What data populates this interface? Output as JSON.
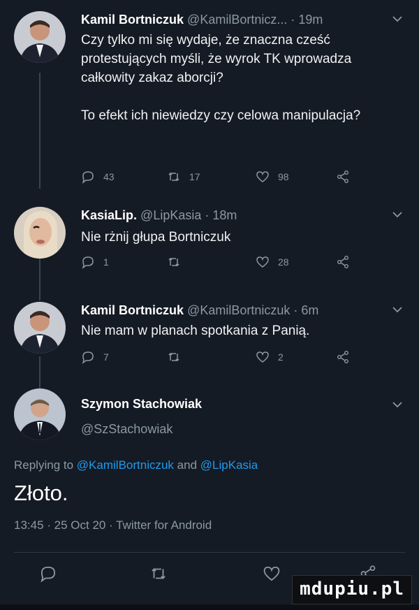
{
  "tweets": [
    {
      "name": "Kamil Bortniczuk",
      "handle": "@KamilBortnicz...",
      "time": "· 19m",
      "text": "Czy tylko mi się wydaje, że znaczna cześć protestujących myśli, że wyrok TK wprowadza całkowity zakaz aborcji?\n\nTo efekt ich niewiedzy czy celowa manipulacja?",
      "replies": "43",
      "retweets": "17",
      "likes": "98"
    },
    {
      "name": "KasiaLip.",
      "handle": "@LipKasia",
      "time": "· 18m",
      "text": "Nie rżnij głupa Bortniczuk",
      "replies": "1",
      "retweets": "",
      "likes": "28"
    },
    {
      "name": "Kamil Bortniczuk",
      "handle": "@KamilBortniczuk",
      "time": "· 6m",
      "text": "Nie mam w planach spotkania z Panią.",
      "replies": "7",
      "retweets": "",
      "likes": "2"
    }
  ],
  "main_tweet": {
    "name": "Szymon Stachowiak",
    "handle": "@SzStachowiak",
    "replying_prefix": "Replying to",
    "mention_1": "@KamilBortniczuk",
    "and_word": "and",
    "mention_2": "@LipKasia",
    "text": "Złoto.",
    "timestamp": "13:45 · 25 Oct 20 · Twitter for Android"
  },
  "watermark": "mdupiu.pl",
  "colors": {
    "background": "#151b24",
    "mention": "#1d9bf0",
    "muted": "#8b98a5"
  }
}
